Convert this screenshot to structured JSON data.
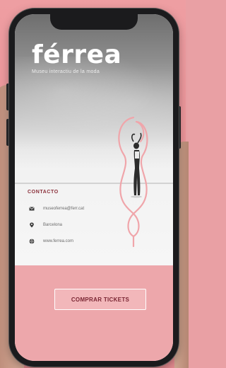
{
  "app": {
    "brand": "férrea",
    "tagline": "Museu interactiu de la moda"
  },
  "contact": {
    "heading": "CONTACTO",
    "items": [
      {
        "icon": "mail-icon",
        "text": "museoferrea@ferr.cat"
      },
      {
        "icon": "location-pin-icon",
        "text": "Barcelona"
      },
      {
        "icon": "globe-icon",
        "text": "www.ferrea.com"
      }
    ]
  },
  "cta": {
    "label": "COMPRAR TICKETS"
  },
  "colors": {
    "accent": "#eda7ab",
    "heading": "#8a2f3a",
    "button_text": "#7a2633",
    "backdrop": "#e9a0a4",
    "phone_frame": "#1b1b1d",
    "line_art": "#f0a5aa"
  }
}
